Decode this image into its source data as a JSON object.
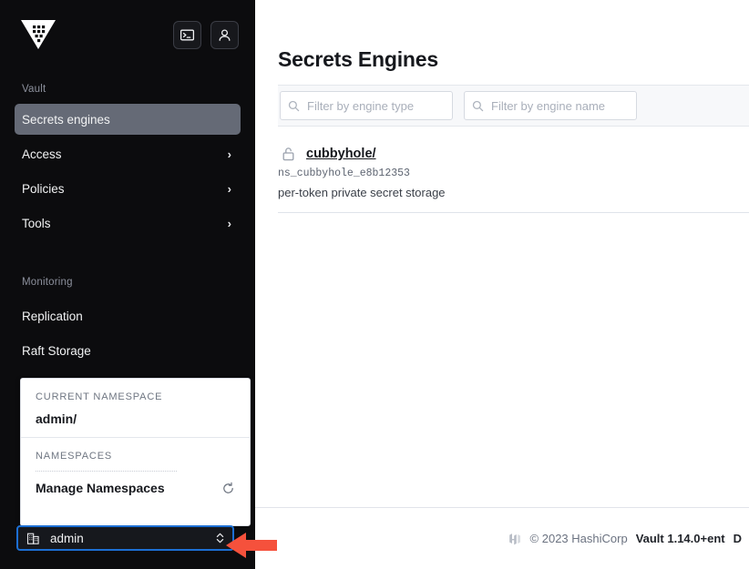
{
  "colors": {
    "sidebar_bg": "#0c0c0e",
    "sidebar_active": "#656a76",
    "focus_ring": "#1c6fd4",
    "annotation_arrow": "#f5513c",
    "filter_bar_bg": "#f7f8fa"
  },
  "sidebar": {
    "logo_icon": "vault-logo-icon",
    "header_buttons": [
      {
        "icon": "terminal-console-icon",
        "name": "web-cli-toggle"
      },
      {
        "icon": "user-person-icon",
        "name": "user-menu"
      }
    ],
    "sections": [
      {
        "label": "Vault",
        "items": [
          {
            "label": "Secrets engines",
            "active": true,
            "chevron": false
          },
          {
            "label": "Access",
            "active": false,
            "chevron": true
          },
          {
            "label": "Policies",
            "active": false,
            "chevron": true
          },
          {
            "label": "Tools",
            "active": false,
            "chevron": true
          }
        ]
      },
      {
        "label": "Monitoring",
        "items": [
          {
            "label": "Replication",
            "active": false,
            "chevron": false
          },
          {
            "label": "Raft Storage",
            "active": false,
            "chevron": false
          }
        ]
      }
    ],
    "chevron_glyph": "›"
  },
  "namespace_panel": {
    "current_heading": "CURRENT NAMESPACE",
    "current_value": "admin/",
    "list_heading": "NAMESPACES",
    "manage_label": "Manage Namespaces",
    "refresh_icon": "refresh-icon"
  },
  "namespace_picker": {
    "icon": "building-icon",
    "value": "admin",
    "selector_icon": "up-down-chevron-icon"
  },
  "main": {
    "title": "Secrets Engines",
    "filters": [
      {
        "name": "engine-type",
        "placeholder": "Filter by engine type",
        "value": "",
        "icon": "search-icon"
      },
      {
        "name": "engine-name",
        "placeholder": "Filter by engine name",
        "value": "",
        "icon": "search-icon"
      }
    ],
    "engines": [
      {
        "icon": "unlocked-padlock-icon",
        "path": "cubbyhole/",
        "accessor": "ns_cubbyhole_e8b12353",
        "description": "per-token private secret storage"
      }
    ]
  },
  "footer": {
    "logo_icon": "hashicorp-logo-icon",
    "copyright": "© 2023 HashiCorp",
    "version": "Vault 1.14.0+ent",
    "docs_label": "D"
  }
}
